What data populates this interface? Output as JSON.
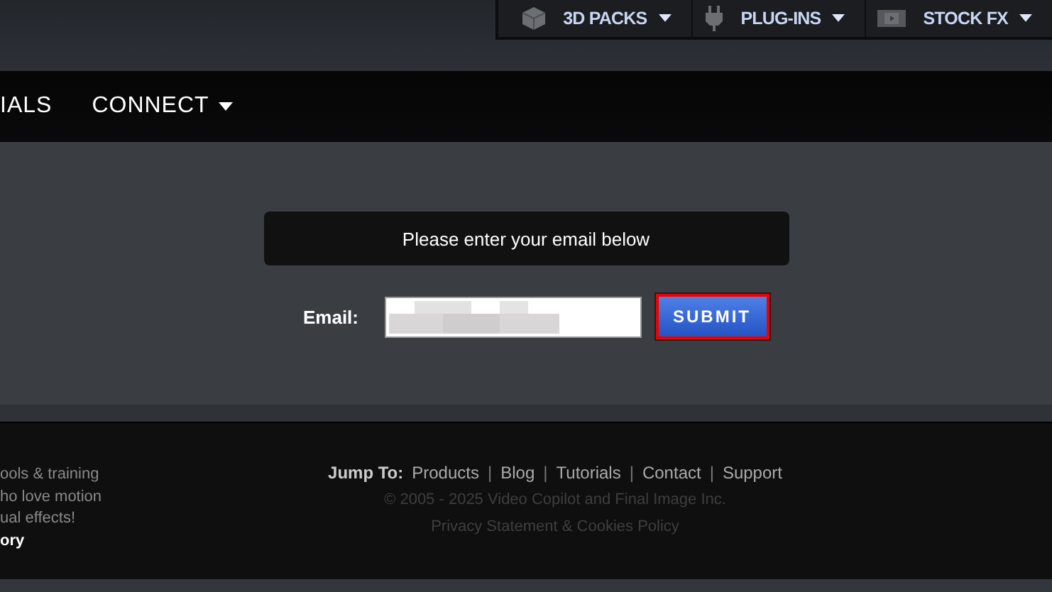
{
  "top_menu": [
    {
      "label": "3D PACKS",
      "kind": "cube",
      "dropdown": true
    },
    {
      "label": "PLUG-INS",
      "kind": "plug",
      "dropdown": true
    },
    {
      "label": "STOCK FX",
      "kind": "film",
      "dropdown": true
    }
  ],
  "main_nav": [
    {
      "label": "IALS",
      "dropdown": false
    },
    {
      "label": "CONNECT",
      "dropdown": true
    }
  ],
  "form": {
    "message": "Please enter your email below",
    "email_label": "Email:",
    "button": "SUBMIT"
  },
  "footer": {
    "about_lines": [
      "ools & training",
      "ho love motion",
      "ual effects!"
    ],
    "about_link": "ory",
    "jump_label": "Jump To:",
    "link_separator": "|",
    "links": [
      "Products",
      "Blog",
      "Tutorials",
      "Contact",
      "Support"
    ],
    "copyright": "© 2005 - 2025 Video Copilot and Final Image Inc.",
    "privacy": "Privacy Statement & Cookies Policy"
  }
}
